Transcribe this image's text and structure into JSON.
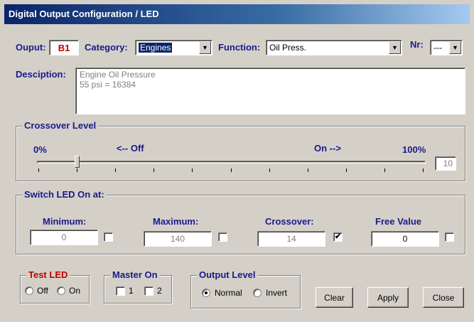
{
  "window": {
    "title": "Digital Output Configuration / LED"
  },
  "output": {
    "label": "Ouput:",
    "value": "B1"
  },
  "category": {
    "label": "Category:",
    "value": "Engines"
  },
  "function": {
    "label": "Function:",
    "value": "Oil Press."
  },
  "nr": {
    "label": "Nr:",
    "value": "---"
  },
  "description": {
    "label": "Desciption:",
    "line1": "Engine Oil Pressure",
    "line2": "55 psi = 16384"
  },
  "crossover_level": {
    "title": "Crossover Level",
    "min_label": "0%",
    "off_label": "<-- Off",
    "on_label": "On -->",
    "max_label": "100%",
    "value": "10",
    "slider_fraction": 0.1
  },
  "switch_led": {
    "title": "Switch LED On at:",
    "minimum": {
      "label": "Minimum:",
      "value": "0",
      "checked": false
    },
    "maximum": {
      "label": "Maximum:",
      "value": "140",
      "checked": false
    },
    "crossover": {
      "label": "Crossover:",
      "value": "14",
      "checked": true
    },
    "free_value": {
      "label": "Free Value",
      "value": "0",
      "checked": false
    }
  },
  "test_led": {
    "title": "Test LED",
    "off": "Off",
    "on": "On"
  },
  "master_on": {
    "title": "Master On",
    "opt1": "1",
    "opt2": "2"
  },
  "output_level": {
    "title": "Output Level",
    "normal": "Normal",
    "invert": "Invert",
    "selected": "Normal"
  },
  "buttons": {
    "clear": "Clear",
    "apply": "Apply",
    "close": "Close"
  },
  "colors": {
    "title_start": "#0a246a",
    "title_end": "#a6caf0",
    "label": "#1a1a8c",
    "accent_red": "#c00000"
  }
}
